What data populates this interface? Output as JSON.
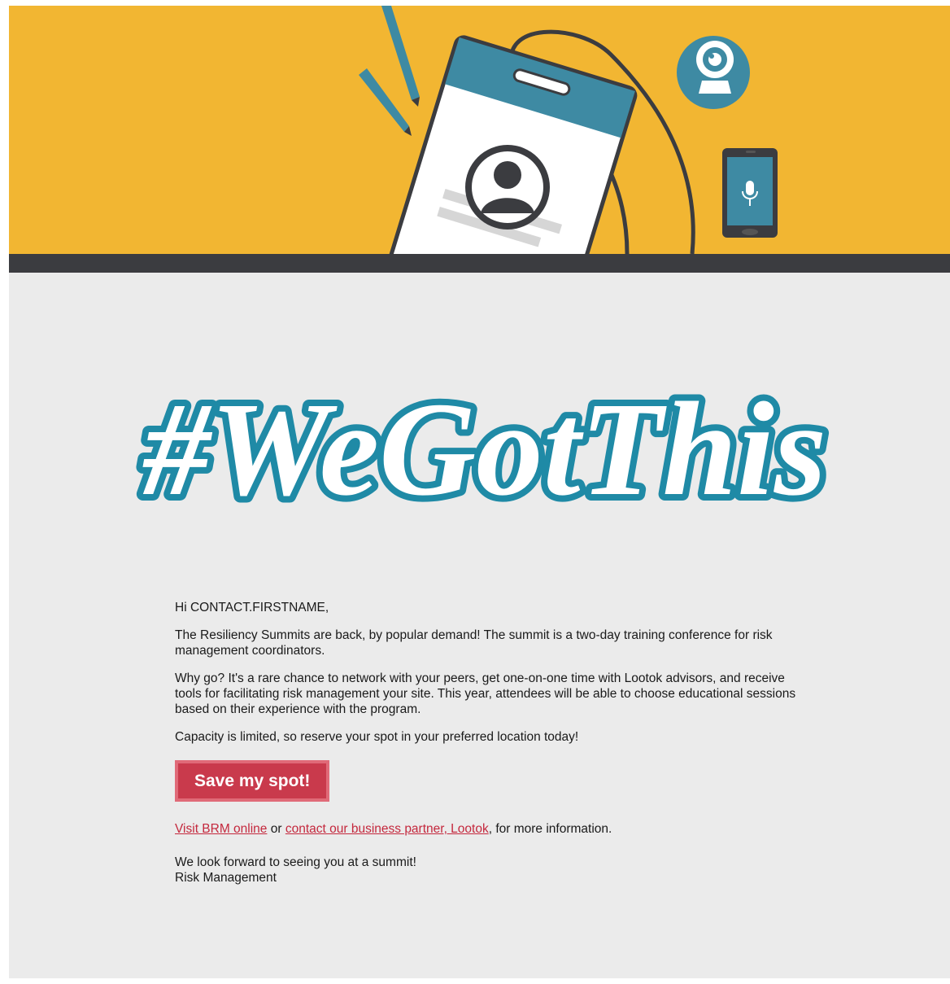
{
  "banner": {
    "icons": [
      "pencil-icon",
      "id-badge-icon",
      "user-avatar-icon",
      "webcam-icon",
      "smartphone-microphone-icon"
    ],
    "colors": {
      "background": "#f2b632",
      "teal": "#3e8aa3",
      "dark": "#3b3c40"
    }
  },
  "hashtag": {
    "text": "#WeGotThis",
    "fill": "#ffffff",
    "stroke": "#1f8aa6"
  },
  "email": {
    "greeting": "Hi CONTACT.FIRSTNAME,",
    "paragraph_1": "The Resiliency Summits are back, by popular demand! The summit is a two-day training conference for risk management coordinators.",
    "paragraph_2": "Why go? It's a rare chance to network with your peers, get one-on-one time with Lootok advisors, and receive tools for facilitating risk management your site. This year, attendees will be able to choose educational sessions based on their experience with the program.",
    "paragraph_3": "Capacity is limited, so reserve your spot in your preferred location today!",
    "cta_label": "Save my spot!",
    "link_brm": "Visit BRM online",
    "connector_or": " or ",
    "link_lootok": "contact our business partner, Lootok",
    "info_suffix": ", for more information.",
    "signoff_line": "We look forward to seeing you at a summit!",
    "signature": "Risk Management"
  },
  "colors": {
    "cta": "#c93a4c",
    "link": "#c4283d",
    "body_bg": "#ebebeb"
  }
}
